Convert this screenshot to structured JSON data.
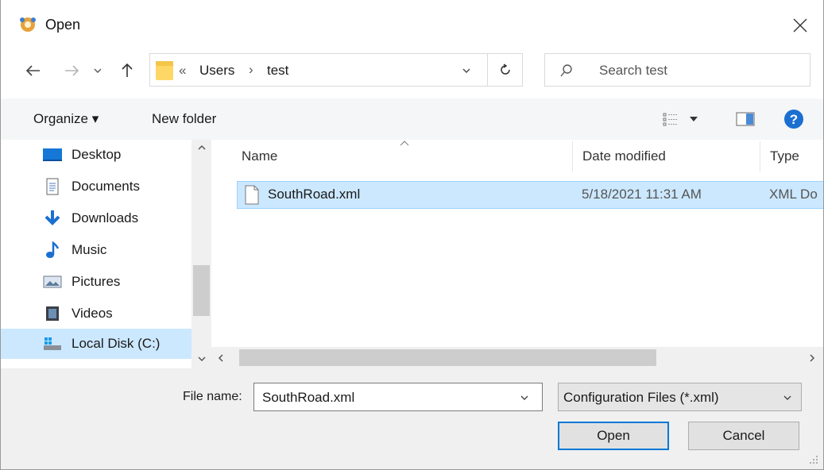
{
  "window": {
    "title": "Open"
  },
  "address": {
    "overflow": "«",
    "crumbs": [
      "Users",
      "test"
    ],
    "separator": "›"
  },
  "search": {
    "placeholder": "Search test"
  },
  "toolbar": {
    "organize_label": "Organize ▾",
    "new_folder_label": "New folder"
  },
  "nav": {
    "items": [
      {
        "label": "Desktop",
        "icon": "desktop-icon"
      },
      {
        "label": "Documents",
        "icon": "documents-icon"
      },
      {
        "label": "Downloads",
        "icon": "downloads-icon"
      },
      {
        "label": "Music",
        "icon": "music-icon"
      },
      {
        "label": "Pictures",
        "icon": "pictures-icon"
      },
      {
        "label": "Videos",
        "icon": "videos-icon"
      },
      {
        "label": "Local Disk (C:)",
        "icon": "drive-icon",
        "selected": true
      }
    ]
  },
  "columns": {
    "name": "Name",
    "date": "Date modified",
    "type": "Type"
  },
  "files": [
    {
      "name": "SouthRoad.xml",
      "date": "5/18/2021 11:31 AM",
      "type": "XML Do"
    }
  ],
  "bottom": {
    "file_name_label": "File name:",
    "file_name_value": "SouthRoad.xml",
    "filter_value": "Configuration Files (*.xml)",
    "open_label": "Open",
    "cancel_label": "Cancel"
  },
  "colors": {
    "selection": "#cce8ff",
    "selection_border": "#99d1ff",
    "accent": "#0078d7"
  }
}
